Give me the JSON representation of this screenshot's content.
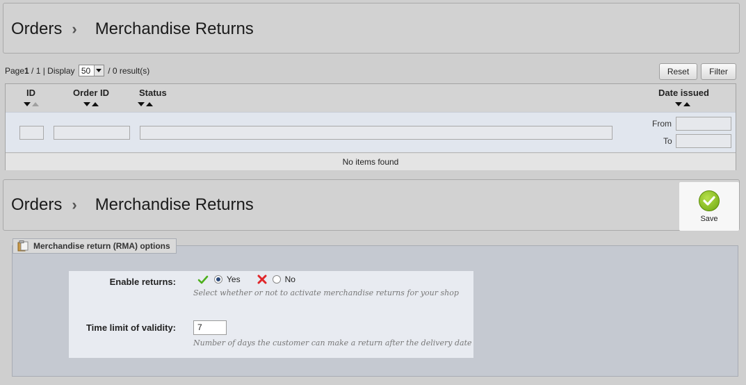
{
  "top_toolbar": {
    "crumb_parent": "Orders",
    "separator": "›",
    "crumb_current": "Merchandise Returns"
  },
  "pager": {
    "page_label": "Page",
    "page_current": "1",
    "page_total": " / 1 | Display ",
    "display_value": "50",
    "results": " / 0 result(s)"
  },
  "buttons": {
    "reset": "Reset",
    "filter": "Filter",
    "save": "Save"
  },
  "table": {
    "columns": [
      "ID",
      "Order ID",
      "Status",
      "Date issued"
    ],
    "date_from": "From",
    "date_to": "To",
    "empty_message": "No items found"
  },
  "mid_toolbar": {
    "crumb_parent": "Orders",
    "separator": "›",
    "crumb_current": "Merchandise Returns"
  },
  "options": {
    "legend": "Merchandise return (RMA) options",
    "enable_label": "Enable returns:",
    "yes": "Yes",
    "no": "No",
    "enable_hint": "Select whether or not to activate merchandise returns for your shop",
    "time_label": "Time limit of validity:",
    "time_value": "7",
    "time_hint": "Number of days the customer can make a return after the delivery date",
    "selected": "Yes"
  },
  "colors": {
    "save_green": "#7bb31a",
    "yes_check": "#4caf1c",
    "no_cross": "#e0262a"
  }
}
